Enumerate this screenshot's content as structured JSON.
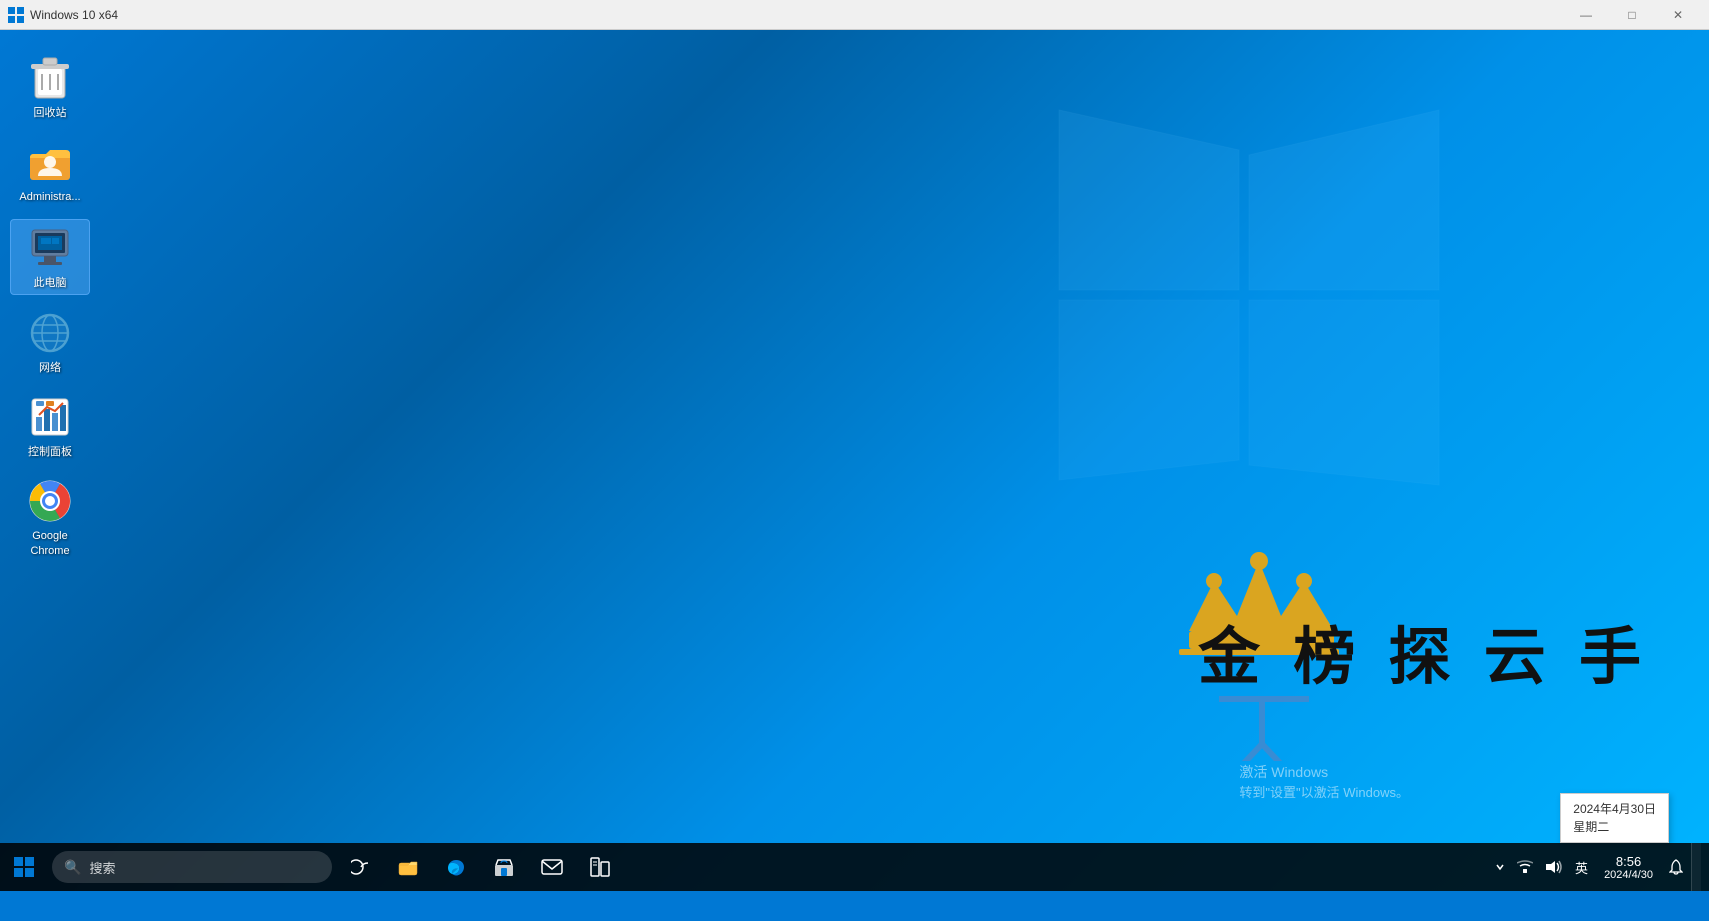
{
  "titlebar": {
    "title": "Windows 10 x64",
    "icon": "🖥",
    "minimize": "—",
    "maximize": "□",
    "close": "✕"
  },
  "desktop": {
    "icons": [
      {
        "id": "recycle-bin",
        "label": "回收站",
        "icon": "recycle"
      },
      {
        "id": "administrator",
        "label": "Administra...",
        "icon": "user-folder"
      },
      {
        "id": "this-pc",
        "label": "此电脑",
        "icon": "computer",
        "selected": true
      },
      {
        "id": "network",
        "label": "网络",
        "icon": "network"
      },
      {
        "id": "control-panel",
        "label": "控制面板",
        "icon": "control-panel"
      },
      {
        "id": "google-chrome",
        "label": "Google Chrome",
        "icon": "chrome"
      }
    ],
    "watermark": {
      "line1": "激活 Windows",
      "line2": "转到\"设置\"以激活 Windows。"
    },
    "brand_text": "金 榜 探 云 手"
  },
  "taskbar": {
    "search_placeholder": "搜索",
    "clock": {
      "time": "8:56",
      "date": "2024/4/30",
      "tooltip_date": "2024年4月30日",
      "tooltip_day": "星期二"
    },
    "lang": "英"
  }
}
